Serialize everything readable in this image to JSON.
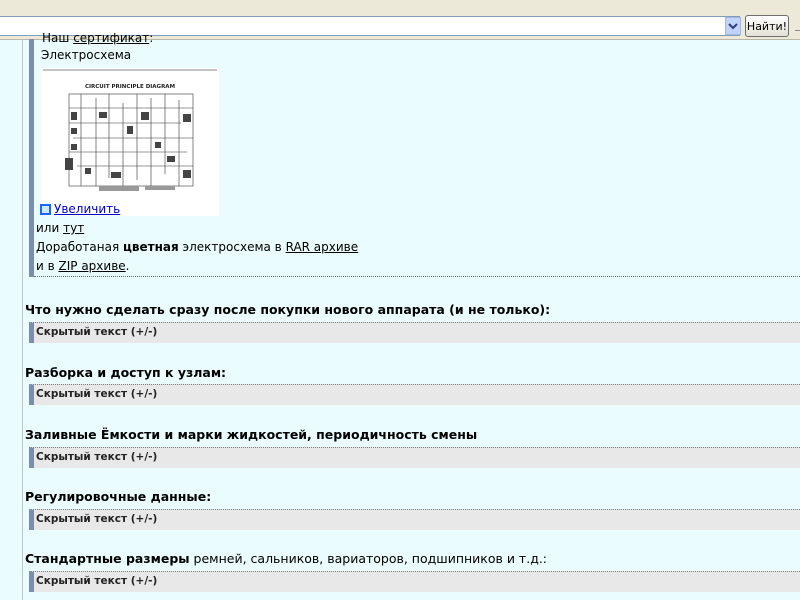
{
  "findbar": {
    "search_value": "",
    "find_button": "Найти!",
    "dropdown_icon": "chevron-down-icon"
  },
  "post": {
    "cert_prefix": "Наш",
    "cert_link": "сертификат",
    "cert_suffix": ":",
    "schema_label": "Электросхема",
    "image_caption": "CIRCUIT PRINCIPLE DIAGRAM",
    "enlarge_link": "Увеличить",
    "or_text": "или",
    "here_link": "тут",
    "reworked_prefix": "Доработаная",
    "reworked_bold": "цветная",
    "reworked_mid": "электросхема в",
    "rar_link": "RAR архиве",
    "and_in": "и в",
    "zip_link": "ZIP архиве",
    "period": "."
  },
  "sections": [
    {
      "title": "Что нужно сделать сразу после покупки нового аппарата (и не только):",
      "spoiler": "Скрытый текст (+/-)"
    },
    {
      "title": "Разборка и доступ к узлам:",
      "spoiler": "Скрытый текст (+/-)"
    },
    {
      "title": "Заливные Ёмкости и марки жидкостей, периодичность смены",
      "spoiler": "Скрытый текст (+/-)"
    },
    {
      "title": "Регулировочные данные:",
      "spoiler": "Скрытый текст (+/-)"
    },
    {
      "title_bold": "Стандартные размеры",
      "title_rest": " ремней, сальников, вариаторов, подшипников и т.д.:",
      "spoiler": "Скрытый текст (+/-)"
    }
  ]
}
